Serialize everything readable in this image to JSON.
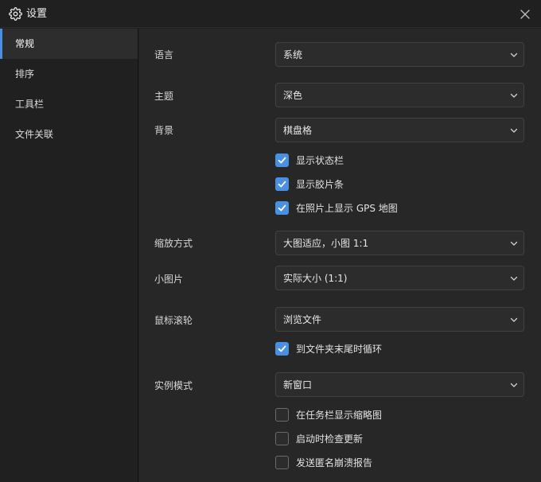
{
  "window": {
    "title": "设置"
  },
  "sidebar": {
    "items": [
      {
        "label": "常规",
        "active": true
      },
      {
        "label": "排序",
        "active": false
      },
      {
        "label": "工具栏",
        "active": false
      },
      {
        "label": "文件关联",
        "active": false
      }
    ]
  },
  "settings": {
    "language": {
      "label": "语言",
      "value": "系统"
    },
    "theme": {
      "label": "主题",
      "value": "深色"
    },
    "background": {
      "label": "背景",
      "value": "棋盘格"
    },
    "show_statusbar": {
      "label": "显示状态栏",
      "checked": true
    },
    "show_filmstrip": {
      "label": "显示胶片条",
      "checked": true
    },
    "show_gps_map": {
      "label": "在照片上显示 GPS 地图",
      "checked": true
    },
    "zoom_mode": {
      "label": "缩放方式",
      "value": "大图适应，小图 1:1"
    },
    "small_image": {
      "label": "小图片",
      "value": "实际大小 (1:1)"
    },
    "mouse_wheel": {
      "label": "鼠标滚轮",
      "value": "浏览文件"
    },
    "loop_at_end": {
      "label": "到文件夹末尾时循环",
      "checked": true
    },
    "instance_mode": {
      "label": "实例模式",
      "value": "新窗口"
    },
    "taskbar_thumbnail": {
      "label": "在任务栏显示缩略图",
      "checked": false
    },
    "check_updates": {
      "label": "启动时检查更新",
      "checked": false
    },
    "send_crash_reports": {
      "label": "发送匿名崩溃报告",
      "checked": false
    }
  },
  "colors": {
    "accent": "#4a90e2",
    "background": "#202020",
    "panel": "#272727",
    "control": "#2c2c2c"
  }
}
